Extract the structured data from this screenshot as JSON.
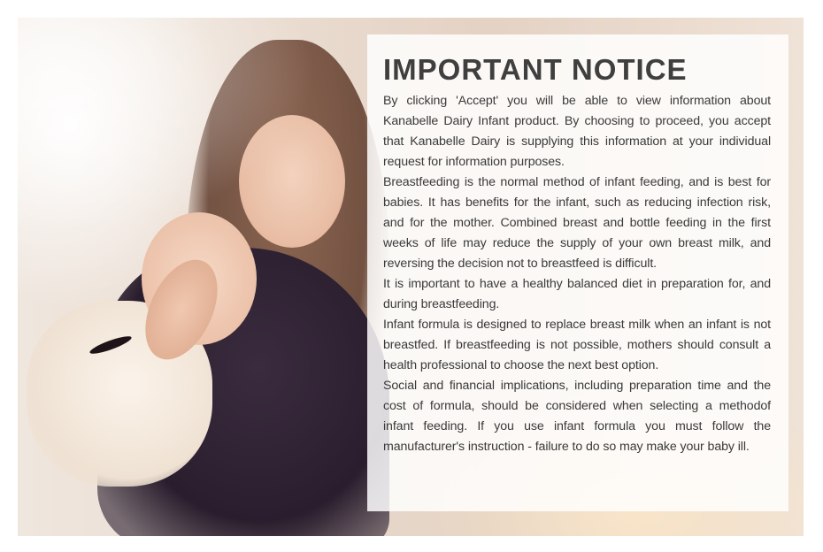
{
  "notice": {
    "title": "IMPORTANT NOTICE",
    "paragraphs": [
      "By clicking 'Accept' you will be able to view information about Kanabelle Dairy Infant product. By choosing to proceed, you accept that Kanabelle Dairy is supplying this information at your individual request for information purposes.",
      "Breastfeeding is the normal method of infant feeding, and is best for babies. It has benefits for the infant, such as reducing infection risk, and for the mother. Combined breast and bottle feeding in the first weeks of life may reduce the supply of your own breast milk, and reversing the decision not to breastfeed is difficult.",
      "It is important to have a healthy balanced diet in preparation for, and during breastfeeding.",
      "Infant formula is designed to replace breast milk when an infant is not breastfed. If breastfeeding is not possible, mothers should consult a health professional to choose the next best option.",
      "Social and financial implications, including preparation time and the cost of formula, should be considered when selecting a methodof infant feeding. If you use infant formula you must follow the manufacturer's instruction - failure to do so may make your baby ill."
    ]
  },
  "colors": {
    "title_text": "#3f3f3f",
    "body_text": "#3a3a3a",
    "panel_background": "#ffffff"
  }
}
